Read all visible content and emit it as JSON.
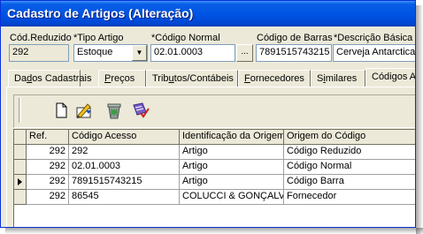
{
  "window": {
    "title": "Cadastro de Artigos (Alteração)"
  },
  "form": {
    "cod_reduzido": {
      "label": "Cód.Reduzido",
      "value": "292"
    },
    "tipo_artigo": {
      "label": "*Tipo Artigo",
      "value": "Estoque"
    },
    "codigo_normal": {
      "label": "*Código Normal",
      "value": "02.01.0003",
      "button": "..."
    },
    "codigo_barras": {
      "label": "Código de Barras",
      "value": "7891515743215"
    },
    "descricao_basica": {
      "label": "*Descrição Básica",
      "value": "Cerveja Antarctica"
    }
  },
  "tabs": [
    {
      "pre": "Da",
      "u": "d",
      "post": "os Cadastrais"
    },
    {
      "pre": "",
      "u": "P",
      "post": "reços"
    },
    {
      "pre": "Trib",
      "u": "u",
      "post": "tos/Contábeis"
    },
    {
      "pre": "",
      "u": "F",
      "post": "ornecedores"
    },
    {
      "pre": "S",
      "u": "i",
      "post": "milares"
    },
    {
      "pre": "Códigos Ac",
      "u": "",
      "post": ""
    }
  ],
  "toolbar": {
    "icons": [
      "new-icon",
      "edit-icon",
      "delete-icon",
      "save-icon"
    ]
  },
  "grid": {
    "columns": [
      "Ref.",
      "Código Acesso",
      "Identificação da Origem",
      "Origem do Código"
    ],
    "rows": [
      {
        "ref": "292",
        "codigo": "292",
        "identificacao": "Artigo",
        "origem": "Código Reduzido"
      },
      {
        "ref": "292",
        "codigo": "02.01.0003",
        "identificacao": "Artigo",
        "origem": "Código Normal"
      },
      {
        "ref": "292",
        "codigo": "7891515743215",
        "identificacao": "Artigo",
        "origem": "Código Barra"
      },
      {
        "ref": "292",
        "codigo": "86545",
        "identificacao": "COLUCCI & GONÇALVES",
        "origem": "Fornecedor"
      }
    ],
    "current_row_index": 2
  },
  "colors": {
    "titlebar": "#0054e3",
    "face": "#ece9d8",
    "field_border": "#7f9db9"
  }
}
